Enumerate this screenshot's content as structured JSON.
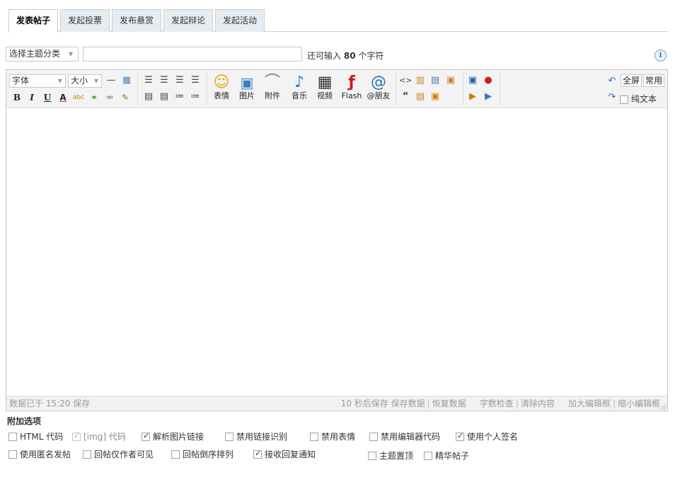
{
  "tabs": [
    {
      "label": "发表帖子",
      "active": true
    },
    {
      "label": "发起投票",
      "active": false
    },
    {
      "label": "发布悬赏",
      "active": false
    },
    {
      "label": "发起辩论",
      "active": false
    },
    {
      "label": "发起活动",
      "active": false
    }
  ],
  "subject": {
    "type_select": "选择主题分类",
    "value": "",
    "remaining_prefix": "还可输入",
    "remaining_count": "80",
    "remaining_suffix": "个字符",
    "info_glyph": "i"
  },
  "toolbar": {
    "font_select": "字体",
    "size_select": "大小",
    "hr_glyph": "—",
    "bold": "B",
    "italic": "I",
    "underline": "U",
    "fontcolor": "A",
    "spell": "abc",
    "buttons": [
      {
        "icon": "smiley-icon",
        "glyph": "☺",
        "label": "表情",
        "color": "#e8a400"
      },
      {
        "icon": "image-icon",
        "glyph": "▣",
        "label": "图片",
        "color": "#3b7bbf"
      },
      {
        "icon": "paperclip-icon",
        "glyph": "⌒",
        "label": "附件",
        "color": "#5a7fa8"
      },
      {
        "icon": "music-note-icon",
        "glyph": "♪",
        "label": "音乐",
        "color": "#2a7cd1"
      },
      {
        "icon": "video-icon",
        "glyph": "▦",
        "label": "视频",
        "color": "#333333"
      },
      {
        "icon": "flash-icon",
        "glyph": "ƒ",
        "label": "Flash",
        "color": "#cc1a1a"
      },
      {
        "icon": "at-sign-icon",
        "glyph": "@",
        "label": "@朋友",
        "color": "#2a6fc0"
      }
    ],
    "fullscreen": "全屏",
    "common": "常用",
    "plaintext": "纯文本"
  },
  "editor": {
    "content": ""
  },
  "status": {
    "saved": "数据已于 15:20 保存",
    "autosave": "10 秒后保存",
    "save_data": "保存数据",
    "restore": "恢复数据",
    "wordcheck": "字数检查",
    "clear": "清除内容",
    "enlarge": "加大编辑框",
    "shrink": "缩小编辑框"
  },
  "options": {
    "title": "附加选项",
    "items": [
      {
        "label": "HTML 代码",
        "checked": false,
        "disabled": false
      },
      {
        "label": "[img] 代码",
        "checked": true,
        "disabled": true
      },
      {
        "label": "解析图片链接",
        "checked": true,
        "disabled": false
      },
      {
        "label": "禁用链接识别",
        "checked": false,
        "disabled": false
      },
      {
        "label": "禁用表情",
        "checked": false,
        "disabled": false
      },
      {
        "label": "禁用编辑器代码",
        "checked": false,
        "disabled": false
      },
      {
        "label": "使用个人签名",
        "checked": true,
        "disabled": false
      },
      {
        "label": "使用匿名发帖",
        "checked": false,
        "disabled": false
      },
      {
        "label": "回帖仅作者可见",
        "checked": false,
        "disabled": false
      },
      {
        "label": "回帖倒序排列",
        "checked": false,
        "disabled": false
      },
      {
        "label": "接收回复通知",
        "checked": true,
        "disabled": false
      },
      {
        "label": "主题置顶",
        "checked": false,
        "disabled": false
      },
      {
        "label": "精华帖子",
        "checked": false,
        "disabled": false
      }
    ]
  }
}
